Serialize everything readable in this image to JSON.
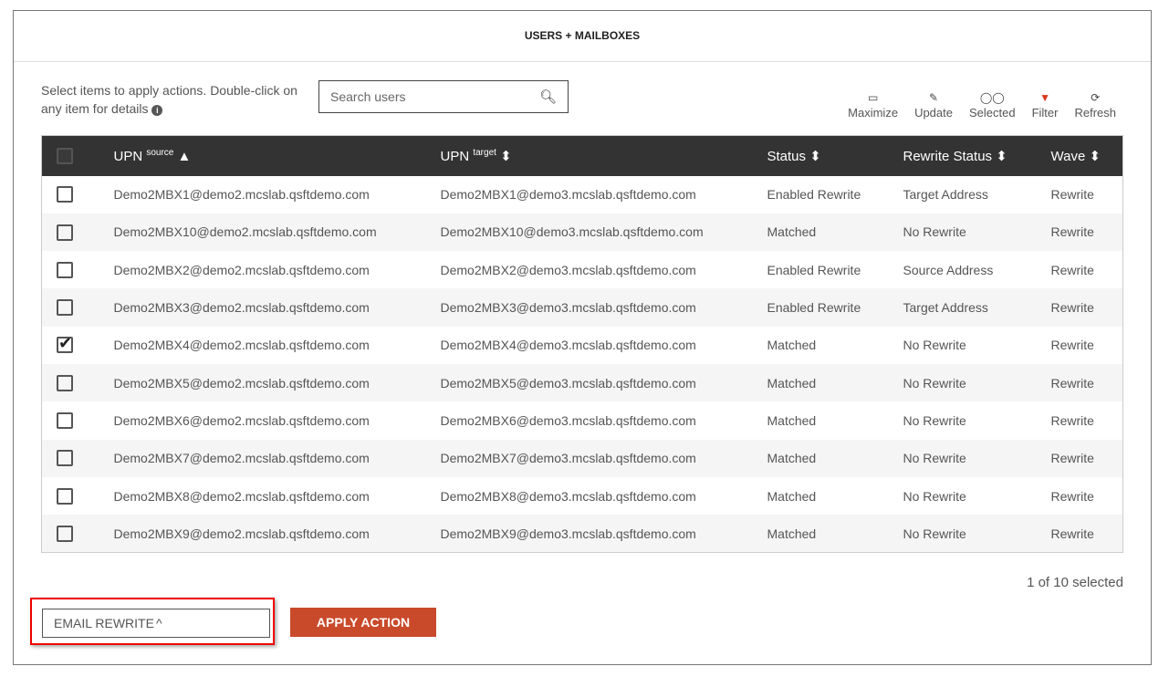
{
  "title": "USERS + MAILBOXES",
  "hint": "Select items to apply actions. Double-click on any item for details",
  "search": {
    "placeholder": "Search users"
  },
  "toolbar": [
    {
      "label": "Maximize",
      "icon": "window-maximize-icon"
    },
    {
      "label": "Update",
      "icon": "edit-icon"
    },
    {
      "label": "Selected",
      "icon": "toggle-icon"
    },
    {
      "label": "Filter",
      "icon": "filter-icon"
    },
    {
      "label": "Refresh",
      "icon": "refresh-icon"
    }
  ],
  "columns": {
    "upn_source": "UPN",
    "source_sup": "source",
    "upn_target": "UPN",
    "target_sup": "target",
    "status": "Status",
    "rewrite": "Rewrite Status",
    "wave": "Wave"
  },
  "rows": [
    {
      "checked": false,
      "src": "Demo2MBX1@demo2.mcslab.qsftdemo.com",
      "tgt": "Demo2MBX1@demo3.mcslab.qsftdemo.com",
      "status": "Enabled Rewrite",
      "rewrite": "Target Address",
      "wave": "Rewrite"
    },
    {
      "checked": false,
      "src": "Demo2MBX10@demo2.mcslab.qsftdemo.com",
      "tgt": "Demo2MBX10@demo3.mcslab.qsftdemo.com",
      "status": "Matched",
      "rewrite": "No Rewrite",
      "wave": "Rewrite"
    },
    {
      "checked": false,
      "src": "Demo2MBX2@demo2.mcslab.qsftdemo.com",
      "tgt": "Demo2MBX2@demo3.mcslab.qsftdemo.com",
      "status": "Enabled Rewrite",
      "rewrite": "Source Address",
      "wave": "Rewrite"
    },
    {
      "checked": false,
      "src": "Demo2MBX3@demo2.mcslab.qsftdemo.com",
      "tgt": "Demo2MBX3@demo3.mcslab.qsftdemo.com",
      "status": "Enabled Rewrite",
      "rewrite": "Target Address",
      "wave": "Rewrite"
    },
    {
      "checked": true,
      "src": "Demo2MBX4@demo2.mcslab.qsftdemo.com",
      "tgt": "Demo2MBX4@demo3.mcslab.qsftdemo.com",
      "status": "Matched",
      "rewrite": "No Rewrite",
      "wave": "Rewrite"
    },
    {
      "checked": false,
      "src": "Demo2MBX5@demo2.mcslab.qsftdemo.com",
      "tgt": "Demo2MBX5@demo3.mcslab.qsftdemo.com",
      "status": "Matched",
      "rewrite": "No Rewrite",
      "wave": "Rewrite"
    },
    {
      "checked": false,
      "src": "Demo2MBX6@demo2.mcslab.qsftdemo.com",
      "tgt": "Demo2MBX6@demo3.mcslab.qsftdemo.com",
      "status": "Matched",
      "rewrite": "No Rewrite",
      "wave": "Rewrite"
    },
    {
      "checked": false,
      "src": "Demo2MBX7@demo2.mcslab.qsftdemo.com",
      "tgt": "Demo2MBX7@demo3.mcslab.qsftdemo.com",
      "status": "Matched",
      "rewrite": "No Rewrite",
      "wave": "Rewrite"
    },
    {
      "checked": false,
      "src": "Demo2MBX8@demo2.mcslab.qsftdemo.com",
      "tgt": "Demo2MBX8@demo3.mcslab.qsftdemo.com",
      "status": "Matched",
      "rewrite": "No Rewrite",
      "wave": "Rewrite"
    },
    {
      "checked": false,
      "src": "Demo2MBX9@demo2.mcslab.qsftdemo.com",
      "tgt": "Demo2MBX9@demo3.mcslab.qsftdemo.com",
      "status": "Matched",
      "rewrite": "No Rewrite",
      "wave": "Rewrite"
    }
  ],
  "selection_count": "1 of 10 selected",
  "action_select": {
    "value": "EMAIL REWRITE"
  },
  "apply_label": "APPLY ACTION",
  "colors": {
    "accent": "#c94a2a",
    "filter": "#d9381e",
    "header": "#333333"
  }
}
